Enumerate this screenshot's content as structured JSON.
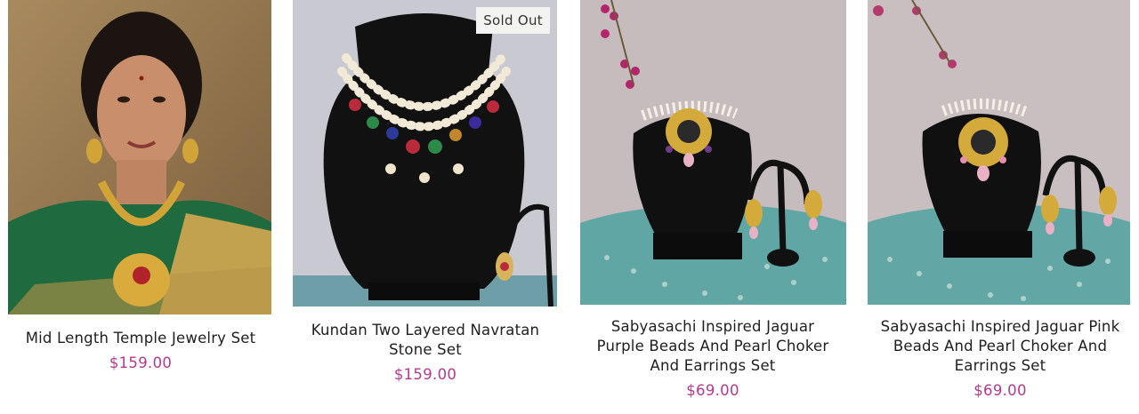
{
  "colors": {
    "price": "#b33a8e",
    "badge_bg": "#f3f3f1"
  },
  "products": [
    {
      "title": "Mid Length Temple Jewelry Set",
      "price": "$159.00",
      "image": "woman-green-saree-temple-necklace"
    },
    {
      "title": "Kundan Two Layered Navratan Stone Set",
      "price": "$159.00",
      "badge": "Sold Out",
      "image": "kundan-navratan-necklace-on-bust"
    },
    {
      "title": "Sabyasachi Inspired Jaguar Purple Beads And Pearl Choker And Earrings Set",
      "price": "$69.00",
      "image": "purple-choker-and-earrings-on-bust"
    },
    {
      "title": "Sabyasachi Inspired Jaguar Pink Beads And Pearl Choker And Earrings Set",
      "price": "$69.00",
      "image": "pink-choker-and-earrings-on-bust"
    }
  ]
}
